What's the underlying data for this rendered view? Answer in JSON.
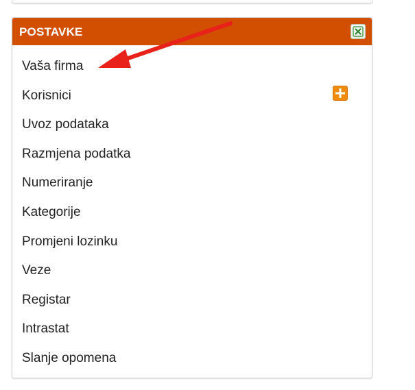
{
  "panel": {
    "title": "POSTAVKE",
    "close_icon": "close-x-icon",
    "header_color": "#d24e00",
    "items": [
      {
        "label": "Vaša firma"
      },
      {
        "label": "Korisnici",
        "action_icon": "plus-icon",
        "action_color": "#f08c10"
      },
      {
        "label": "Uvoz podataka"
      },
      {
        "label": "Razmjena podatka"
      },
      {
        "label": "Numeriranje"
      },
      {
        "label": "Kategorije"
      },
      {
        "label": "Promjeni lozinku"
      },
      {
        "label": "Veze"
      },
      {
        "label": "Registar"
      },
      {
        "label": "Intrastat"
      },
      {
        "label": "Slanje opomena"
      }
    ]
  },
  "annotation": {
    "arrow_icon": "red-arrow-icon",
    "arrow_color": "#e8211b"
  }
}
